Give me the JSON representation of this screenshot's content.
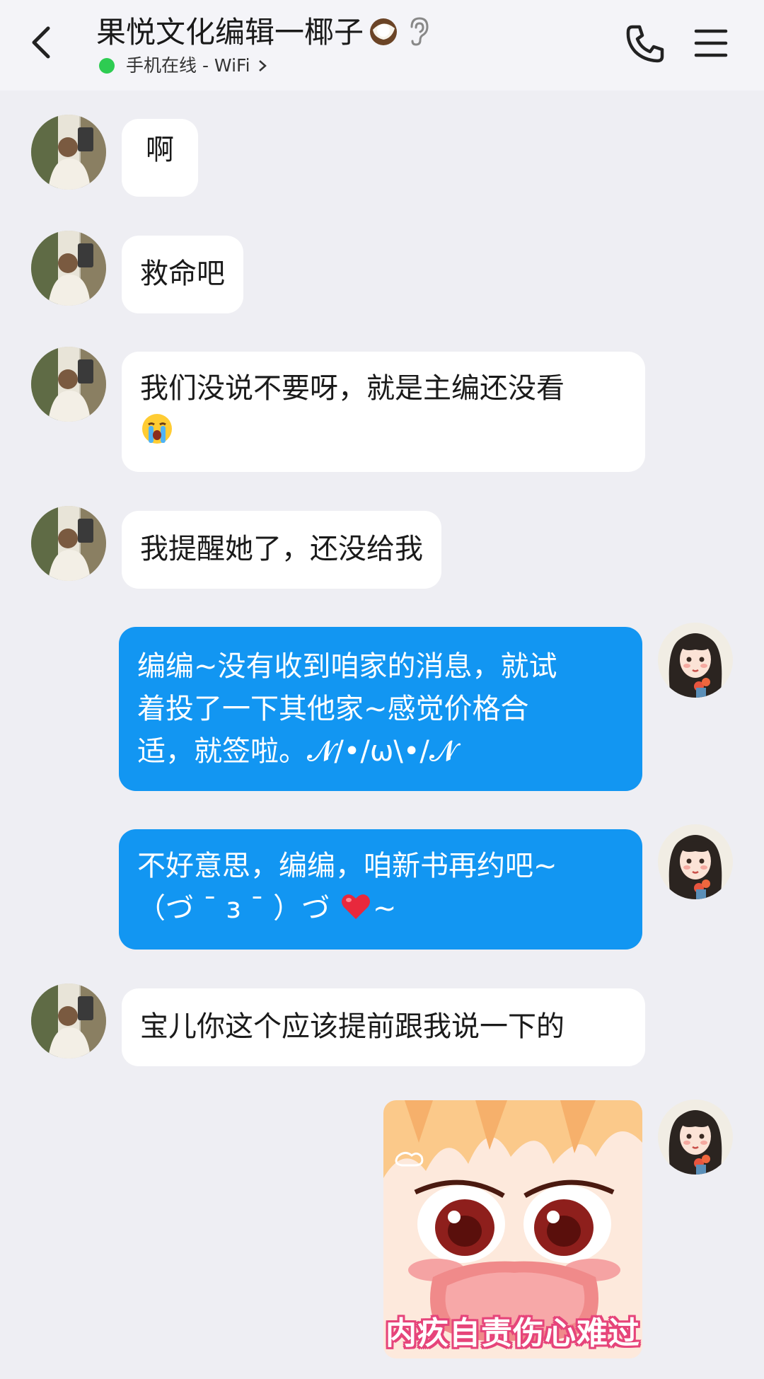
{
  "header": {
    "back_icon": "back-arrow-icon",
    "title": "果悦文化编辑一椰子",
    "title_emoji": "coconut-emoji",
    "ear_icon": "ear-icon",
    "status_text": "手机在线 - WiFi",
    "status_color": "#2ecc52",
    "phone_icon": "phone-icon",
    "menu_icon": "menu-icon"
  },
  "messages": [
    {
      "side": "in",
      "text": "啊"
    },
    {
      "side": "in",
      "text": "救命吧"
    },
    {
      "side": "in",
      "text": "我们没说不要呀，就是主编还没看",
      "emoji": "crying-face-emoji"
    },
    {
      "side": "in",
      "text": "我提醒她了，还没给我"
    },
    {
      "side": "out",
      "line1": "编编~没有收到咱家的消息，就试",
      "line2": "着投了一下其他家~感觉价格合",
      "line3": "适，就签啦。𝓝/•/ω\\•/𝓝"
    },
    {
      "side": "out",
      "line1": "不好意思，编编，咱新书再约吧~",
      "line2": "（づ ˉ ɜ ˉ ）づ ",
      "emoji": "heart-emoji",
      "tail": "~"
    },
    {
      "side": "in",
      "text": "宝儿你这个应该提前跟我说一下的"
    },
    {
      "side": "out",
      "sticker": "crying-anime-girl-sticker",
      "caption": "内疚自责伤心难过"
    }
  ],
  "colors": {
    "background": "#eeeef3",
    "incoming_bubble": "#ffffff",
    "outgoing_bubble": "#1296f2"
  }
}
